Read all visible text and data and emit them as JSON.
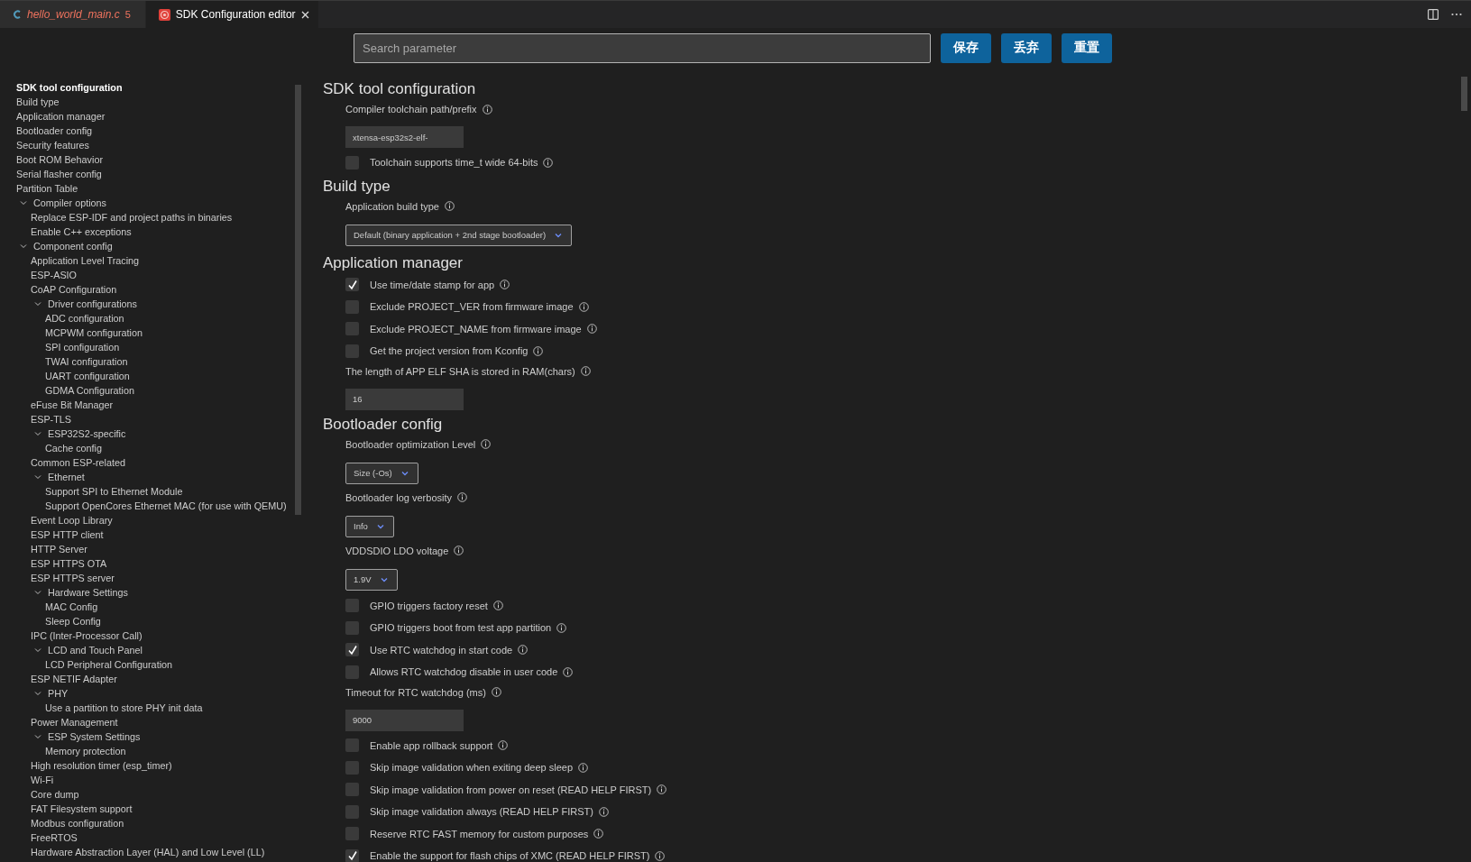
{
  "tabs": [
    {
      "label": "hello_world_main.c",
      "badge": "5",
      "selected": false,
      "kind": "c-file"
    },
    {
      "label": "SDK Configuration editor",
      "selected": true,
      "kind": "config"
    }
  ],
  "search": {
    "placeholder": "Search parameter"
  },
  "buttons": [
    "保存",
    "丢弃",
    "重置"
  ],
  "sidebar": {
    "items": [
      {
        "label": "SDK tool configuration",
        "selected": true
      },
      {
        "label": "Build type",
        "selected": false
      },
      {
        "label": "Application manager",
        "selected": false
      },
      {
        "label": "Bootloader config",
        "selected": false
      },
      {
        "label": "Security features",
        "selected": false
      },
      {
        "label": "Boot ROM Behavior",
        "selected": false
      },
      {
        "label": "Serial flasher config",
        "selected": false
      },
      {
        "label": "Partition Table",
        "selected": false
      },
      {
        "label": "Compiler options",
        "selected": false,
        "expanded": true,
        "children": [
          {
            "label": "Replace ESP-IDF and project paths in binaries",
            "selected": false
          },
          {
            "label": "Enable C++ exceptions",
            "selected": false
          }
        ]
      },
      {
        "label": "Component config",
        "selected": false,
        "expanded": true,
        "children": [
          {
            "label": "Application Level Tracing",
            "selected": false
          },
          {
            "label": "ESP-ASIO",
            "selected": false
          },
          {
            "label": "CoAP Configuration",
            "selected": false
          },
          {
            "label": "Driver configurations",
            "selected": false,
            "expanded": true,
            "children": [
              {
                "label": "ADC configuration",
                "selected": false
              },
              {
                "label": "MCPWM configuration",
                "selected": false
              },
              {
                "label": "SPI configuration",
                "selected": false
              },
              {
                "label": "TWAI configuration",
                "selected": false
              },
              {
                "label": "UART configuration",
                "selected": false
              },
              {
                "label": "GDMA Configuration",
                "selected": false
              }
            ]
          },
          {
            "label": "eFuse Bit Manager",
            "selected": false
          },
          {
            "label": "ESP-TLS",
            "selected": false
          },
          {
            "label": "ESP32S2-specific",
            "selected": false,
            "expanded": true,
            "children": [
              {
                "label": "Cache config",
                "selected": false
              }
            ]
          },
          {
            "label": "Common ESP-related",
            "selected": false
          },
          {
            "label": "Ethernet",
            "selected": false,
            "expanded": true,
            "children": [
              {
                "label": "Support SPI to Ethernet Module",
                "selected": false
              },
              {
                "label": "Support OpenCores Ethernet MAC (for use with QEMU)",
                "selected": false
              }
            ]
          },
          {
            "label": "Event Loop Library",
            "selected": false
          },
          {
            "label": "ESP HTTP client",
            "selected": false
          },
          {
            "label": "HTTP Server",
            "selected": false
          },
          {
            "label": "ESP HTTPS OTA",
            "selected": false
          },
          {
            "label": "ESP HTTPS server",
            "selected": false
          },
          {
            "label": "Hardware Settings",
            "selected": false,
            "expanded": true,
            "children": [
              {
                "label": "MAC Config",
                "selected": false
              },
              {
                "label": "Sleep Config",
                "selected": false
              }
            ]
          },
          {
            "label": "IPC (Inter-Processor Call)",
            "selected": false
          },
          {
            "label": "LCD and Touch Panel",
            "selected": false,
            "expanded": true,
            "children": [
              {
                "label": "LCD Peripheral Configuration",
                "selected": false
              }
            ]
          },
          {
            "label": "ESP NETIF Adapter",
            "selected": false
          },
          {
            "label": "PHY",
            "selected": false,
            "expanded": true,
            "children": [
              {
                "label": "Use a partition to store PHY init data",
                "selected": false
              }
            ]
          },
          {
            "label": "Power Management",
            "selected": false
          },
          {
            "label": "ESP System Settings",
            "selected": false,
            "expanded": true,
            "children": [
              {
                "label": "Memory protection",
                "selected": false
              }
            ]
          },
          {
            "label": "High resolution timer (esp_timer)",
            "selected": false
          },
          {
            "label": "Wi-Fi",
            "selected": false
          },
          {
            "label": "Core dump",
            "selected": false
          },
          {
            "label": "FAT Filesystem support",
            "selected": false
          },
          {
            "label": "Modbus configuration",
            "selected": false
          },
          {
            "label": "FreeRTOS",
            "selected": false
          },
          {
            "label": "Hardware Abstraction Layer (HAL) and Low Level (LL)",
            "selected": false
          }
        ]
      }
    ]
  },
  "sections": [
    {
      "title": "SDK tool configuration",
      "items": [
        {
          "kind": "text",
          "label": "Compiler toolchain path/prefix",
          "value": "xtensa-esp32s2-elf-"
        },
        {
          "kind": "checkbox",
          "label": "Toolchain supports time_t wide 64-bits",
          "checked": false
        }
      ]
    },
    {
      "title": "Build type",
      "items": [
        {
          "kind": "select",
          "label": "Application build type",
          "value": "Default (binary application + 2nd stage bootloader)"
        }
      ]
    },
    {
      "title": "Application manager",
      "items": [
        {
          "kind": "checkbox",
          "label": "Use time/date stamp for app",
          "checked": true
        },
        {
          "kind": "checkbox",
          "label": "Exclude PROJECT_VER from firmware image",
          "checked": false
        },
        {
          "kind": "checkbox",
          "label": "Exclude PROJECT_NAME from firmware image",
          "checked": false
        },
        {
          "kind": "checkbox",
          "label": "Get the project version from Kconfig",
          "checked": false
        },
        {
          "kind": "text",
          "label": "The length of APP ELF SHA is stored in RAM(chars)",
          "value": "16"
        }
      ]
    },
    {
      "title": "Bootloader config",
      "items": [
        {
          "kind": "select",
          "label": "Bootloader optimization Level",
          "value": "Size (-Os)"
        },
        {
          "kind": "select",
          "label": "Bootloader log verbosity",
          "value": "Info"
        },
        {
          "kind": "select",
          "label": "VDDSDIO LDO voltage",
          "value": "1.9V"
        },
        {
          "kind": "checkbox",
          "label": "GPIO triggers factory reset",
          "checked": false
        },
        {
          "kind": "checkbox",
          "label": "GPIO triggers boot from test app partition",
          "checked": false
        },
        {
          "kind": "checkbox",
          "label": "Use RTC watchdog in start code",
          "checked": true
        },
        {
          "kind": "checkbox",
          "label": "Allows RTC watchdog disable in user code",
          "checked": false
        },
        {
          "kind": "text",
          "label": "Timeout for RTC watchdog (ms)",
          "value": "9000"
        },
        {
          "kind": "checkbox",
          "label": "Enable app rollback support",
          "checked": false
        },
        {
          "kind": "checkbox",
          "label": "Skip image validation when exiting deep sleep",
          "checked": false
        },
        {
          "kind": "checkbox",
          "label": "Skip image validation from power on reset (READ HELP FIRST)",
          "checked": false
        },
        {
          "kind": "checkbox",
          "label": "Skip image validation always (READ HELP FIRST)",
          "checked": false
        },
        {
          "kind": "checkbox",
          "label": "Reserve RTC FAST memory for custom purposes",
          "checked": false
        },
        {
          "kind": "checkbox",
          "label": "Enable the support for flash chips of XMC (READ HELP FIRST)",
          "checked": true
        }
      ]
    }
  ]
}
